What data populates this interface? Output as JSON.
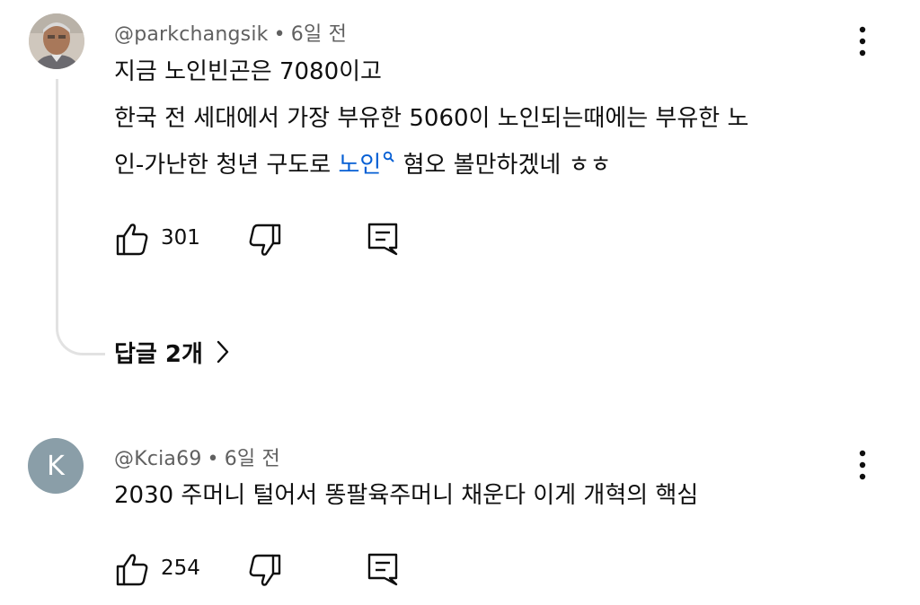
{
  "comments": [
    {
      "author": "@parkchangsik",
      "time": "6일 전",
      "lines": {
        "l1": "지금 노인빈곤은 7080이고",
        "l2": "한국 전 세대에서 가장 부유한 5060이 노인되는때에는 부유한 노",
        "l3_pre": "인-가난한 청년 구도로 ",
        "l3_link": "노인",
        "l3_post": " 혐오 볼만하겠네 ㅎㅎ"
      },
      "likes": "301",
      "replies_label": "답글 2개"
    },
    {
      "author": "@Kcia69",
      "avatar_letter": "K",
      "time": "6일 전",
      "text": "2030 주머니 털어서 똥팔육주머니 채운다 이게 개혁의 핵심",
      "likes": "254"
    }
  ],
  "separator": "•",
  "icons": {
    "like": "thumb-up-icon",
    "dislike": "thumb-down-icon",
    "reply": "comment-reply-icon",
    "more": "more-vertical-icon",
    "search": "search-icon",
    "expand": "chevron-right-icon"
  },
  "colors": {
    "text": "#0f0f0f",
    "meta": "#606060",
    "link": "#065fd4",
    "thread_line": "#e2e2e2",
    "avatar_k": "#8a9ea8"
  }
}
